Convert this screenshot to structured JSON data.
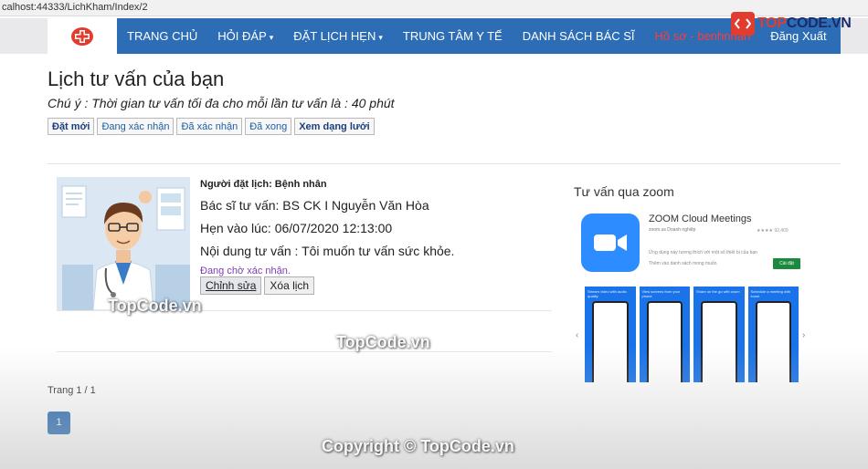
{
  "address": {
    "url": "calhost:44333/LichKham/Index/2"
  },
  "nav": {
    "items": [
      {
        "label": "TRANG CHỦ",
        "caret": false
      },
      {
        "label": "HỎI ĐÁP",
        "caret": true
      },
      {
        "label": "ĐẶT LỊCH HẸN",
        "caret": true
      },
      {
        "label": "TRUNG TÂM Y TẾ",
        "caret": false
      },
      {
        "label": "DANH SÁCH BÁC SĨ",
        "caret": false
      }
    ],
    "profile": "Hồ sơ - benhnhan",
    "logout": "Đăng Xuất"
  },
  "brand": {
    "prefix": "TOP",
    "suffix": "CODE.VN"
  },
  "page": {
    "title": "Lịch tư vấn của bạn",
    "note": "Chú ý : Thời gian tư vấn tối đa cho mỗi lần tư vấn là : 40 phút"
  },
  "filters": [
    "Đặt mới",
    "Đang xác nhận",
    "Đã xác nhận",
    "Đã xong",
    "Xem dạng lưới"
  ],
  "appointment": {
    "booker": "Người đặt lịch: Bệnh nhân",
    "doctor": "Bác sĩ tư vấn: BS CK I Nguyễn Văn Hòa",
    "time": "Hẹn vào lúc: 06/07/2020 12:13:00",
    "content": "Nội dung tư vấn : Tôi muốn tư vấn sức khỏe.",
    "status": "Đang chờ xác nhận.",
    "edit": "Chỉnh sửa",
    "delete": "Xóa lịch"
  },
  "zoom": {
    "title": "Tư vấn qua zoom",
    "app_name": "ZOOM Cloud Meetings",
    "app_sub": "zoom.us   Doanh nghiệp",
    "rating": "★★★★ 92,409",
    "desc": "Ứng dụng này tương thích với một số thiết bị của bạn",
    "wish": "Thêm vào danh sách mong muốn",
    "install": "Cài đặt",
    "shots": [
      "Stream video with audio quality",
      "View screens from your phone",
      "Share on the go with zoom",
      "Schedule a meeting with zoom"
    ]
  },
  "pager": {
    "text": "Trang 1 / 1",
    "current": "1"
  },
  "watermarks": {
    "a": "TopCode.vn",
    "b": "TopCode.vn",
    "c": "Copyright © TopCode.vn"
  },
  "colors": {
    "navbar": "#2c6db5",
    "profile": "#ff3b3b",
    "status": "#7a3fb0",
    "zoom": "#2d8cff"
  }
}
